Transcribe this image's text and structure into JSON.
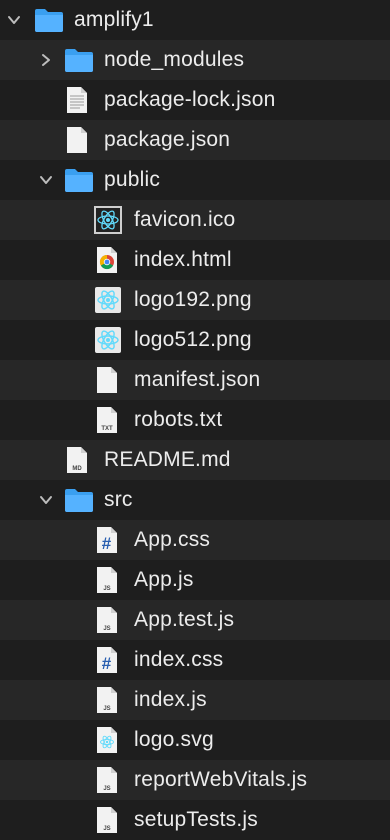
{
  "tree": {
    "items": [
      {
        "label": "amplify1",
        "type": "folder",
        "expanded": true,
        "icon": "folder-icon"
      },
      {
        "label": "node_modules",
        "type": "folder",
        "expanded": false,
        "icon": "folder-icon"
      },
      {
        "label": "package-lock.json",
        "type": "file",
        "icon": "text-file-icon"
      },
      {
        "label": "package.json",
        "type": "file",
        "icon": "blank-file-icon"
      },
      {
        "label": "public",
        "type": "folder",
        "expanded": true,
        "icon": "folder-icon"
      },
      {
        "label": "favicon.ico",
        "type": "file",
        "icon": "react-ico-icon"
      },
      {
        "label": "index.html",
        "type": "file",
        "icon": "chrome-html-icon"
      },
      {
        "label": "logo192.png",
        "type": "file",
        "icon": "react-png-icon"
      },
      {
        "label": "logo512.png",
        "type": "file",
        "icon": "react-png-icon"
      },
      {
        "label": "manifest.json",
        "type": "file",
        "icon": "blank-file-icon"
      },
      {
        "label": "robots.txt",
        "type": "file",
        "icon": "txt-file-icon",
        "badge": "TXT"
      },
      {
        "label": "README.md",
        "type": "file",
        "icon": "md-file-icon",
        "badge": "MD"
      },
      {
        "label": "src",
        "type": "folder",
        "expanded": true,
        "icon": "folder-icon"
      },
      {
        "label": "App.css",
        "type": "file",
        "icon": "css-file-icon",
        "badge": "#"
      },
      {
        "label": "App.js",
        "type": "file",
        "icon": "js-file-icon",
        "badge": "JS"
      },
      {
        "label": "App.test.js",
        "type": "file",
        "icon": "js-file-icon",
        "badge": "JS"
      },
      {
        "label": "index.css",
        "type": "file",
        "icon": "css-file-icon",
        "badge": "#"
      },
      {
        "label": "index.js",
        "type": "file",
        "icon": "js-file-icon",
        "badge": "JS"
      },
      {
        "label": "logo.svg",
        "type": "file",
        "icon": "svg-file-icon"
      },
      {
        "label": "reportWebVitals.js",
        "type": "file",
        "icon": "js-file-icon",
        "badge": "JS"
      },
      {
        "label": "setupTests.js",
        "type": "file",
        "icon": "js-file-icon",
        "badge": "JS"
      }
    ]
  },
  "colors": {
    "background": "#1e1e1e",
    "row_alt": "#272727",
    "folder": "#3a9ff0",
    "text": "#ececec",
    "react": "#61dafb",
    "css_hash": "#2a5fb0"
  }
}
